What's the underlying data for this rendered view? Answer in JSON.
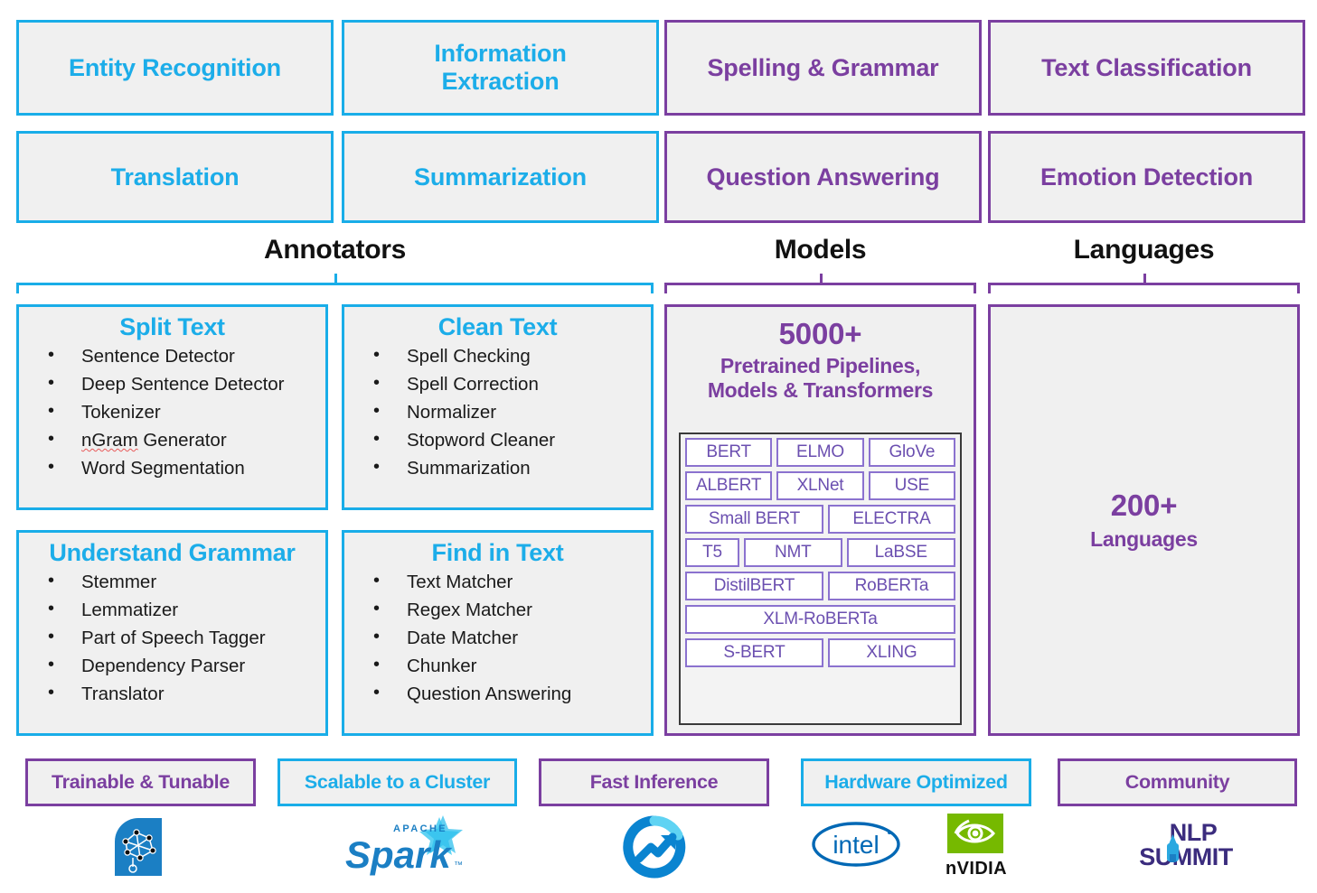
{
  "top_tasks": {
    "cyan": [
      {
        "label": "Entity Recognition"
      },
      {
        "label": "Information Extraction"
      },
      {
        "label": "Translation"
      },
      {
        "label": "Summarization"
      }
    ],
    "purple": [
      {
        "label": "Spelling & Grammar"
      },
      {
        "label": "Text Classification"
      },
      {
        "label": "Question Answering"
      },
      {
        "label": "Emotion Detection"
      }
    ]
  },
  "sections": {
    "annotators": "Annotators",
    "models": "Models",
    "languages": "Languages"
  },
  "annotator_groups": [
    {
      "title": "Split Text",
      "items": [
        "Sentence Detector",
        "Deep Sentence Detector",
        "Tokenizer",
        "nGram Generator",
        "Word Segmentation"
      ],
      "misspelled_index": 3,
      "misspelled_word": "nGram",
      "misspelled_rest": " Generator"
    },
    {
      "title": "Clean Text",
      "items": [
        "Spell Checking",
        "Spell Correction",
        "Normalizer",
        "Stopword Cleaner",
        "Summarization"
      ]
    },
    {
      "title": "Understand Grammar",
      "items": [
        "Stemmer",
        "Lemmatizer",
        "Part of Speech Tagger",
        "Dependency Parser",
        "Translator"
      ]
    },
    {
      "title": "Find in Text",
      "items": [
        "Text Matcher",
        "Regex Matcher",
        "Date Matcher",
        "Chunker",
        "Question Answering"
      ]
    }
  ],
  "models_panel": {
    "count": "5000+",
    "subtitle_line1": "Pretrained Pipelines,",
    "subtitle_line2": "Models & Transformers",
    "chip_rows": [
      [
        "BERT",
        "ELMO",
        "GloVe"
      ],
      [
        "ALBERT",
        "XLNet",
        "USE"
      ],
      [
        "Small BERT",
        "ELECTRA"
      ],
      [
        "T5",
        "NMT",
        "LaBSE"
      ],
      [
        "DistilBERT",
        "RoBERTa"
      ],
      [
        "XLM-RoBERTa"
      ],
      [
        "S-BERT",
        "XLING"
      ]
    ]
  },
  "languages_panel": {
    "count": "200+",
    "label": "Languages"
  },
  "badges": [
    {
      "label": "Trainable & Tunable",
      "color": "purple"
    },
    {
      "label": "Scalable to a Cluster",
      "color": "cyan"
    },
    {
      "label": "Fast Inference",
      "color": "purple"
    },
    {
      "label": "Hardware Optimized",
      "color": "cyan"
    },
    {
      "label": "Community",
      "color": "purple"
    }
  ],
  "logos": [
    {
      "name": "spark-nlp-brain-logo",
      "text": ""
    },
    {
      "name": "apache-spark-logo",
      "text": "Spark",
      "super": "APACHE"
    },
    {
      "name": "fast-inference-speed-logo",
      "text": ""
    },
    {
      "name": "intel-logo",
      "text": "intel"
    },
    {
      "name": "nvidia-logo",
      "text": "nVIDIA"
    },
    {
      "name": "nlp-summit-logo",
      "line1": "NLP",
      "line2": "SUMMIT"
    }
  ],
  "colors": {
    "cyan": "#19ADE8",
    "purple": "#7B3FA0",
    "chip_purple": "#6B4FB0",
    "chip_border": "#8B72CF",
    "panel_bg": "#f0f0f0",
    "text_dark": "#1a1a1a",
    "spark_blue": "#1B7FC4",
    "nvidia_green": "#76B900",
    "intel_blue": "#0068B5"
  }
}
